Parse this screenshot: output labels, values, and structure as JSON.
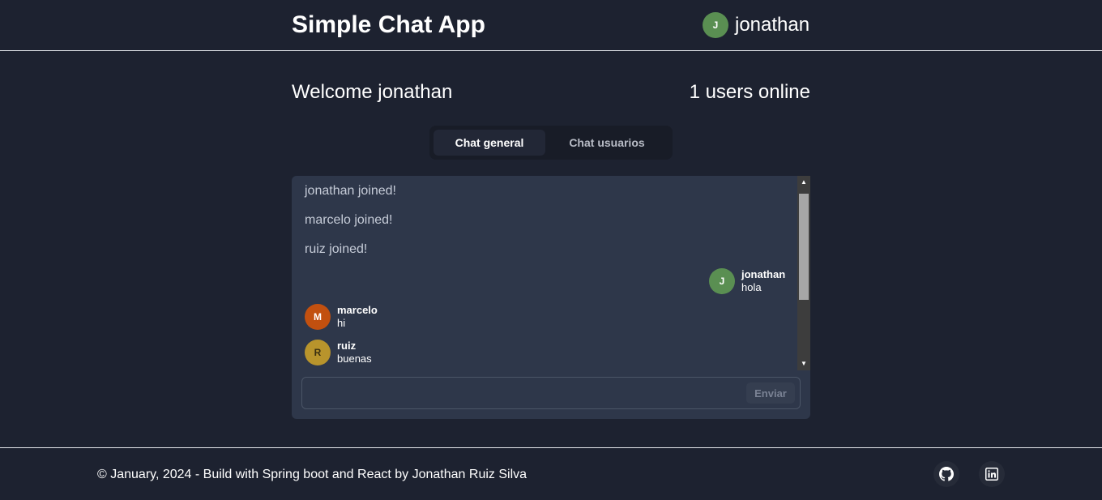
{
  "header": {
    "title": "Simple Chat App",
    "user": {
      "initial": "J",
      "name": "jonathan"
    }
  },
  "welcome": "Welcome jonathan",
  "online_count": "1 users online",
  "tabs": [
    {
      "label": "Chat general",
      "active": true
    },
    {
      "label": "Chat usuarios",
      "active": false
    }
  ],
  "chat": {
    "system_messages": [
      "jonathan joined!",
      "marcelo joined!",
      "ruiz joined!"
    ],
    "messages": [
      {
        "initial": "J",
        "sender": "jonathan",
        "text": "hola",
        "own": true
      },
      {
        "initial": "M",
        "sender": "marcelo",
        "text": "hi",
        "own": false
      },
      {
        "initial": "R",
        "sender": "ruiz",
        "text": "buenas",
        "own": false
      }
    ],
    "input": {
      "value": "",
      "placeholder": ""
    },
    "send_label": "Enviar"
  },
  "footer": {
    "copyright": "© January, 2024 - Build with Spring boot and React by Jonathan Ruiz Silva",
    "links": [
      "github-icon",
      "linkedin-icon"
    ]
  },
  "colors": {
    "background": "#1d2230",
    "panel": "#2e374a",
    "avatar_jonathan": "#5a8f52",
    "avatar_marcelo": "#c2500f",
    "avatar_ruiz": "#b8942c"
  }
}
